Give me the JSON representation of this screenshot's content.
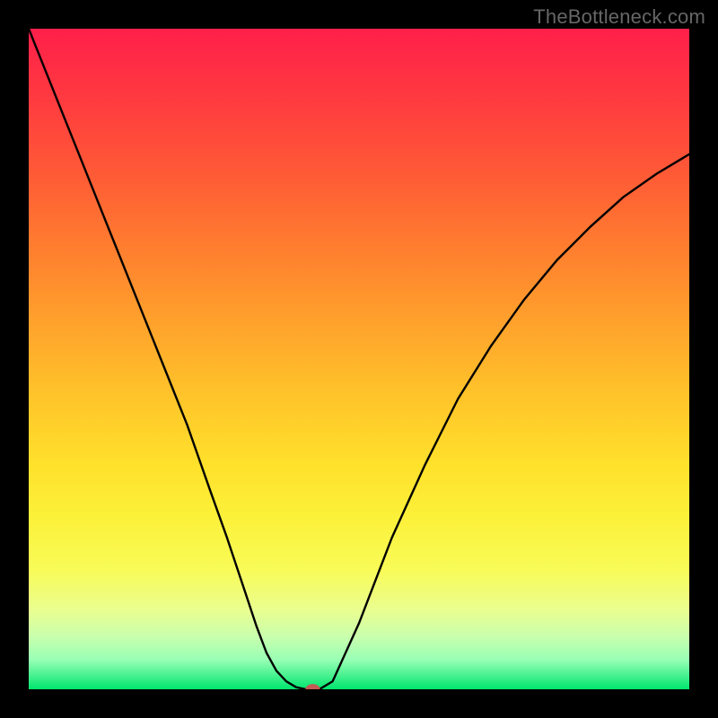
{
  "watermark": "TheBottleneck.com",
  "chart_data": {
    "type": "line",
    "title": "",
    "xlabel": "",
    "ylabel": "",
    "xlim": [
      0,
      1
    ],
    "ylim": [
      0,
      1
    ],
    "series": [
      {
        "name": "curve",
        "x": [
          0.0,
          0.04,
          0.08,
          0.12,
          0.16,
          0.2,
          0.24,
          0.275,
          0.3,
          0.325,
          0.345,
          0.36,
          0.375,
          0.39,
          0.405,
          0.42,
          0.44,
          0.46,
          0.5,
          0.55,
          0.6,
          0.65,
          0.7,
          0.75,
          0.8,
          0.85,
          0.9,
          0.95,
          1.0
        ],
        "values": [
          1.0,
          0.9,
          0.8,
          0.7,
          0.6,
          0.5,
          0.4,
          0.3,
          0.23,
          0.155,
          0.095,
          0.055,
          0.028,
          0.012,
          0.003,
          0.0,
          0.0,
          0.012,
          0.1,
          0.23,
          0.34,
          0.44,
          0.52,
          0.59,
          0.65,
          0.7,
          0.745,
          0.78,
          0.81
        ]
      }
    ],
    "marker": {
      "x": 0.43,
      "y": 0.0,
      "rx": 0.011,
      "ry": 0.008
    },
    "gradient_stops": [
      {
        "pos": 0.0,
        "color": "#ff1f4a"
      },
      {
        "pos": 0.11,
        "color": "#ff3b3f"
      },
      {
        "pos": 0.22,
        "color": "#ff5a36"
      },
      {
        "pos": 0.33,
        "color": "#ff7d2f"
      },
      {
        "pos": 0.44,
        "color": "#ffa02c"
      },
      {
        "pos": 0.55,
        "color": "#ffc22a"
      },
      {
        "pos": 0.66,
        "color": "#ffe12b"
      },
      {
        "pos": 0.74,
        "color": "#fcf13a"
      },
      {
        "pos": 0.82,
        "color": "#f8fb58"
      },
      {
        "pos": 0.88,
        "color": "#eafe8f"
      },
      {
        "pos": 0.92,
        "color": "#c9ffad"
      },
      {
        "pos": 0.955,
        "color": "#99ffb5"
      },
      {
        "pos": 1.0,
        "color": "#00e66e"
      }
    ]
  }
}
